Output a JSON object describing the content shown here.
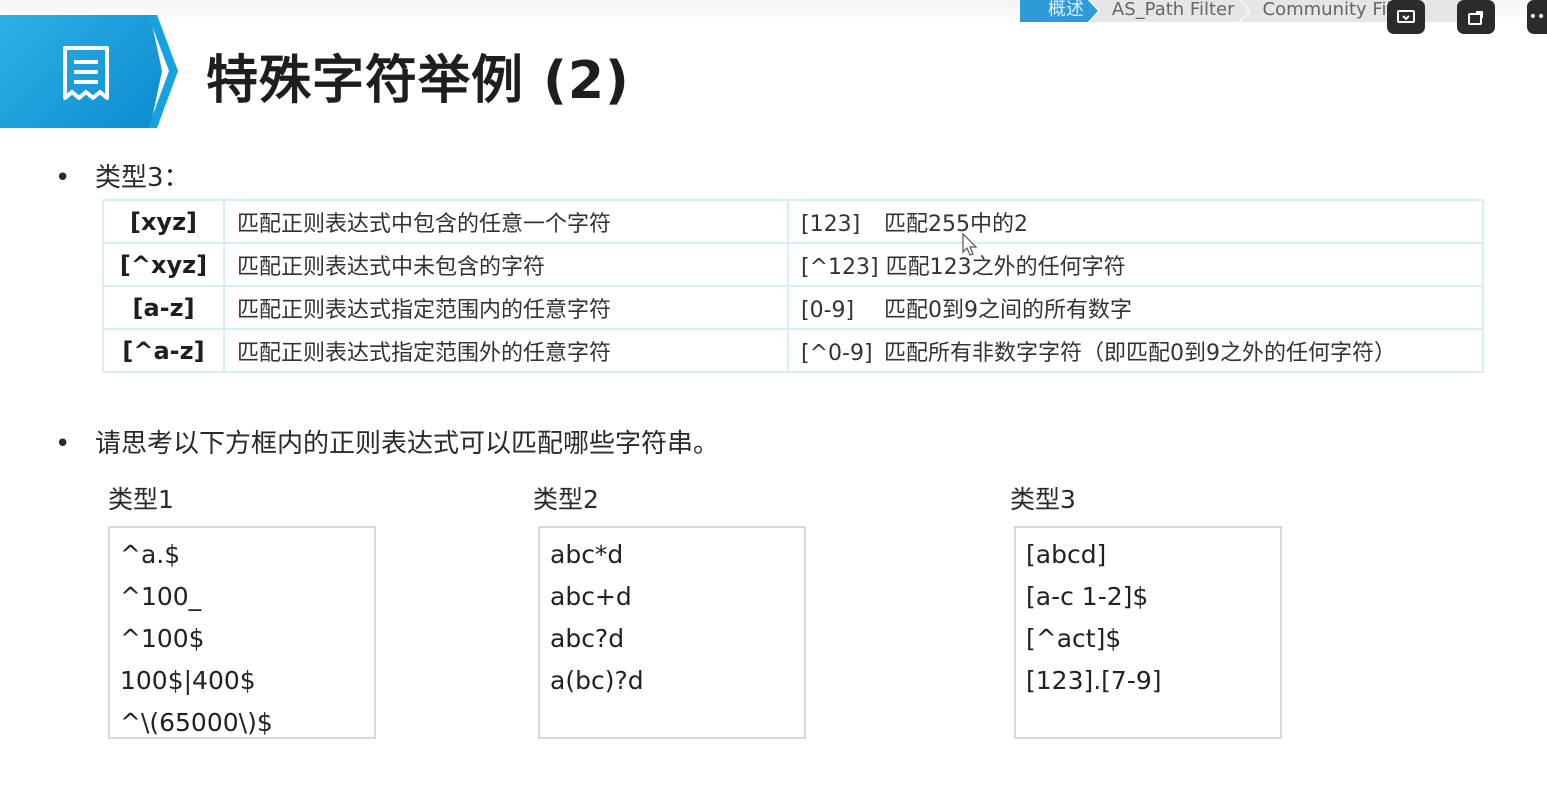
{
  "nav": {
    "crumbs": [
      "概述",
      "AS_Path Filter",
      "Community Filter"
    ],
    "controls": [
      "screen-icon",
      "rotate-icon",
      "more-icon"
    ]
  },
  "title": "特殊字符举例 (2)",
  "bullet1": "类型3：",
  "table": {
    "rows": [
      {
        "pattern": "[xyz]",
        "desc": "匹配正则表达式中包含的任意一个字符",
        "example_code": "[123]",
        "example_desc": "匹配255中的2"
      },
      {
        "pattern": "[^xyz]",
        "desc": "匹配正则表达式中未包含的字符",
        "example_code": "[^123]",
        "example_desc": "匹配123之外的任何字符"
      },
      {
        "pattern": "[a-z]",
        "desc": "匹配正则表达式指定范围内的任意字符",
        "example_code": "[0-9]",
        "example_desc": "匹配0到9之间的所有数字"
      },
      {
        "pattern": "[^a-z]",
        "desc": "匹配正则表达式指定范围外的任意字符",
        "example_code": "[^0-9]",
        "example_desc": "匹配所有非数字字符（即匹配0到9之外的任何字符）"
      }
    ]
  },
  "bullet2": "请思考以下方框内的正则表达式可以匹配哪些字符串。",
  "boxes": [
    {
      "label": "类型1",
      "lines": [
        "^a.$",
        "^100_",
        "^100$",
        "100$|400$",
        "^\\(65000\\)$"
      ]
    },
    {
      "label": "类型2",
      "lines": [
        "abc*d",
        "abc+d",
        "abc?d",
        "a(bc)?d"
      ]
    },
    {
      "label": "类型3",
      "lines": [
        "[abcd]",
        "[a-c 1-2]$",
        "[^act]$",
        "[123].[7-9]"
      ]
    }
  ]
}
